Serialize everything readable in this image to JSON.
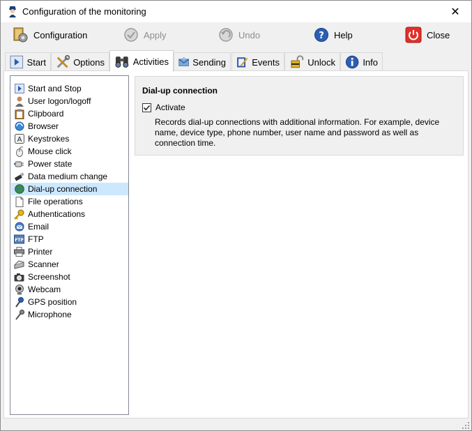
{
  "window": {
    "title": "Configuration of the monitoring",
    "close_glyph": "✕"
  },
  "toolbar": {
    "configuration": "Configuration",
    "apply": "Apply",
    "undo": "Undo",
    "help": "Help",
    "close": "Close"
  },
  "tabs": [
    {
      "label": "Start",
      "icon": "play-icon"
    },
    {
      "label": "Options",
      "icon": "tools-icon"
    },
    {
      "label": "Activities",
      "icon": "binoculars-icon",
      "active": true
    },
    {
      "label": "Sending",
      "icon": "mail-icon"
    },
    {
      "label": "Events",
      "icon": "notepad-icon"
    },
    {
      "label": "Unlock",
      "icon": "padlock-icon"
    },
    {
      "label": "Info",
      "icon": "info-icon"
    }
  ],
  "activities": [
    {
      "label": "Start and Stop",
      "icon": "play-icon"
    },
    {
      "label": "User logon/logoff",
      "icon": "user-icon"
    },
    {
      "label": "Clipboard",
      "icon": "clipboard-icon"
    },
    {
      "label": "Browser",
      "icon": "browser-icon"
    },
    {
      "label": "Keystrokes",
      "icon": "key-icon"
    },
    {
      "label": "Mouse click",
      "icon": "mouse-icon"
    },
    {
      "label": "Power state",
      "icon": "power-plug-icon"
    },
    {
      "label": "Data medium change",
      "icon": "usb-drive-icon"
    },
    {
      "label": "Dial-up connection",
      "icon": "globe-icon",
      "selected": true
    },
    {
      "label": "File operations",
      "icon": "file-icon"
    },
    {
      "label": "Authentications",
      "icon": "key-gold-icon"
    },
    {
      "label": "Email",
      "icon": "email-icon"
    },
    {
      "label": "FTP",
      "icon": "ftp-icon"
    },
    {
      "label": "Printer",
      "icon": "printer-icon"
    },
    {
      "label": "Scanner",
      "icon": "scanner-icon"
    },
    {
      "label": "Screenshot",
      "icon": "camera-icon"
    },
    {
      "label": "Webcam",
      "icon": "webcam-icon"
    },
    {
      "label": "GPS position",
      "icon": "gps-pin-icon"
    },
    {
      "label": "Microphone",
      "icon": "microphone-icon"
    }
  ],
  "detail": {
    "title": "Dial-up connection",
    "checkbox_label": "Activate",
    "checked": true,
    "description": "Records dial-up connections with additional information. For example, device name, device type, phone number, user name and password as well as connection time."
  },
  "colors": {
    "selection": "#cce8ff",
    "window_bg": "#f0f0f0",
    "close_red": "#e0302a",
    "help_blue": "#2c5fb3"
  }
}
